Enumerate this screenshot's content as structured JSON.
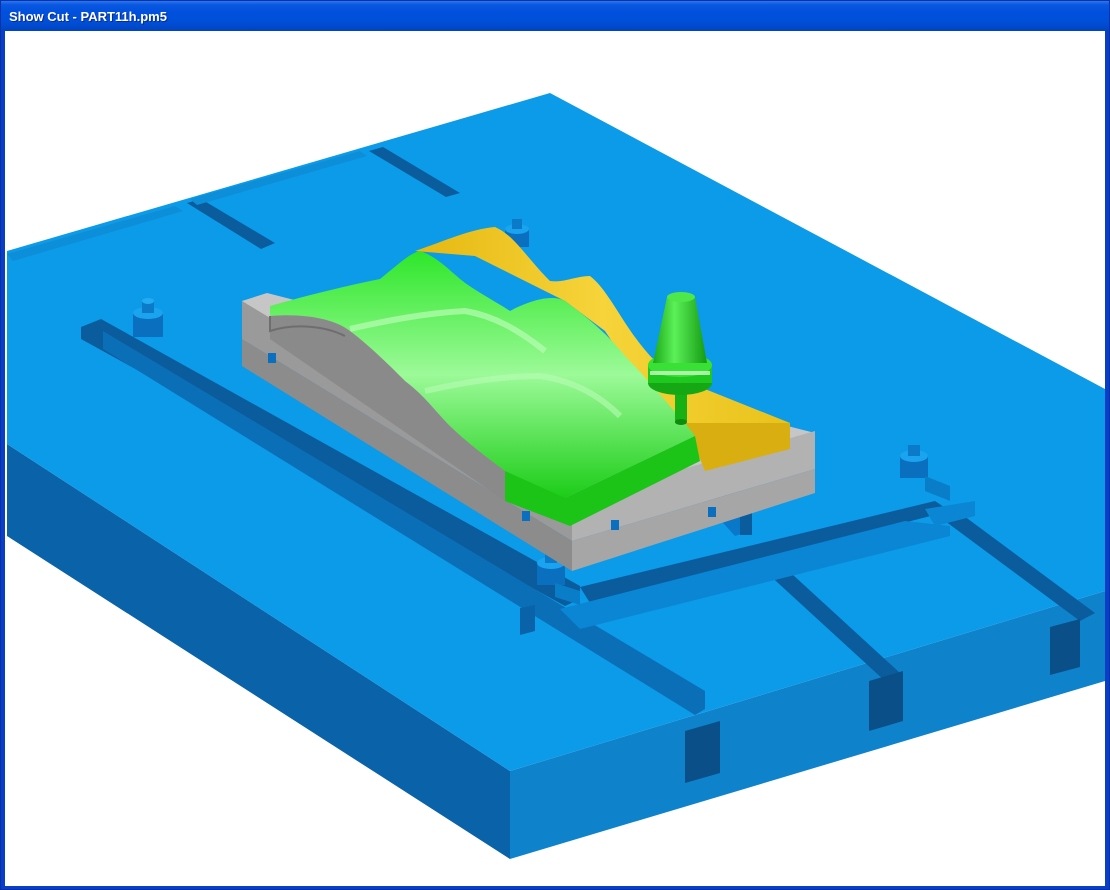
{
  "window": {
    "title": "Show Cut - PART11h.pm5"
  },
  "scene": {
    "description_items": [
      "machine-table",
      "t-slots",
      "fixture-plate",
      "workpiece",
      "milled-surface",
      "unmachined-stock",
      "cutting-tool",
      "clamps"
    ],
    "colors": {
      "table_top": "#0c9be8",
      "table_side_front": "#0f82cc",
      "table_side_left": "#0a62a8",
      "slot": "#0a5c9c",
      "fixture_top": "#c8c8c8",
      "fixture_side": "#a0a0a0",
      "machined": "#22e01c",
      "stock": "#eec519",
      "tool": "#1fc81f"
    }
  }
}
